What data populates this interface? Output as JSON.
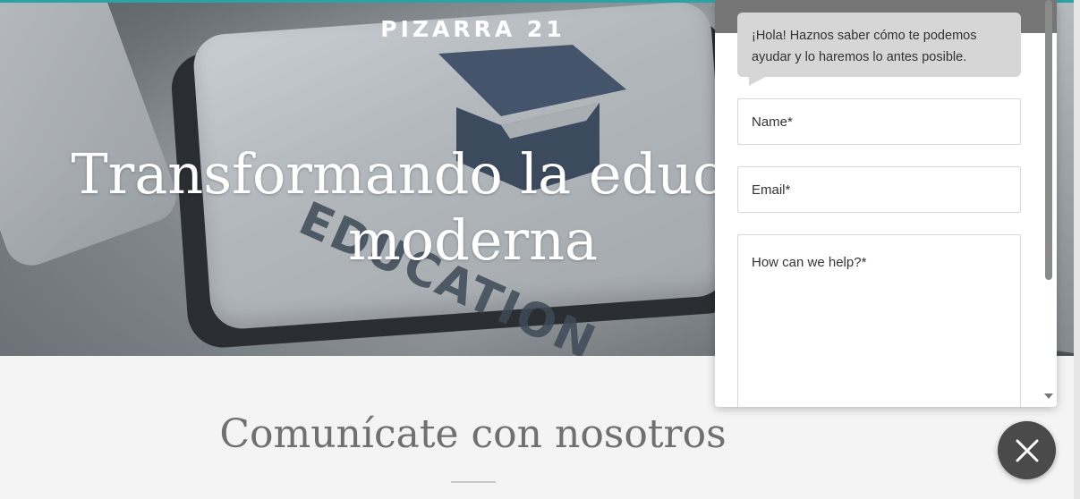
{
  "site": {
    "brand": "PIZARRA 21",
    "hero_title": "Transformando la educación moderna",
    "key_caption": "EDUCATION",
    "section_title": "Comunícate con nosotros",
    "accent_color": "#2aa3a6"
  },
  "chat": {
    "greeting": "¡Hola! Haznos saber cómo te podemos ayudar y lo haremos lo antes posible.",
    "name_placeholder": "Name*",
    "email_placeholder": "Email*",
    "help_placeholder": "How can we help?*",
    "close_icon": "close-icon",
    "header_color": "#757575",
    "fab_color": "#4a4a4a"
  }
}
